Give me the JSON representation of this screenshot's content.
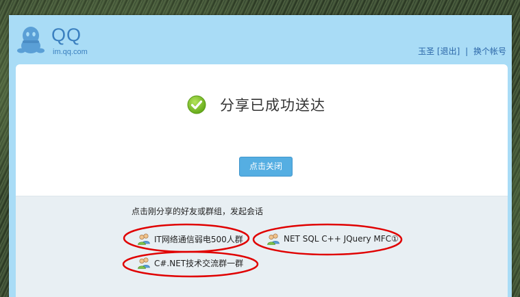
{
  "header": {
    "logo_text": "QQ",
    "logo_url": "im.qq.com",
    "username": "玉圣",
    "logout_label": "[退出]",
    "separator": "|",
    "switch_account_label": "换个帐号"
  },
  "main": {
    "success_message": "分享已成功送达",
    "close_button_label": "点击关闭"
  },
  "bottom": {
    "hint": "点击刚分享的好友或群组，发起会话",
    "groups": [
      {
        "name": "IT网络通信弱电500人群"
      },
      {
        "name": "NET SQL C++ JQuery MFC①"
      },
      {
        "name": "C#.NET技术交流群一群"
      }
    ]
  },
  "colors": {
    "accent": "#a9dcf6",
    "button": "#55aee2",
    "success": "#7dc21e",
    "annotation": "#e00000"
  }
}
